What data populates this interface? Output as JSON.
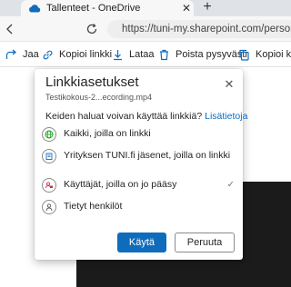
{
  "browser": {
    "tab_title": "Tallenteet - OneDrive",
    "tab_close": "✕",
    "new_tab": "+",
    "url": "https://tuni-my.sharepoint.com/personal/"
  },
  "commandbar": {
    "share": "Jaa",
    "copy_link": "Kopioi linkki",
    "download": "Lataa",
    "delete": "Poista pysyvästi",
    "copy_to": "Kopioi kohteeseen"
  },
  "dialog": {
    "title": "Linkkiasetukset",
    "close": "✕",
    "file_name": "Testikokous-2...ecording.mp4",
    "question": "Keiden haluat voivan käyttää linkkiä?",
    "learn_more": "Lisätietoja",
    "options": [
      {
        "label": "Kaikki, joilla on linkki",
        "icon": "globe-icon"
      },
      {
        "label": "Yrityksen TUNI.fi jäsenet, joilla on linkki",
        "icon": "building-icon"
      },
      {
        "label": "Käyttäjät, joilla on jo pääsy",
        "icon": "people-lock-icon",
        "selected": true
      },
      {
        "label": "Tietyt henkilöt",
        "icon": "person-icon"
      }
    ],
    "selected_mark": "✓",
    "apply": "Käytä",
    "cancel": "Peruuta"
  },
  "colors": {
    "accent": "#0f6cbd",
    "restricted_icon": "#c4314b",
    "globe_icon": "#13a10e",
    "building_icon": "#0f6cbd"
  }
}
